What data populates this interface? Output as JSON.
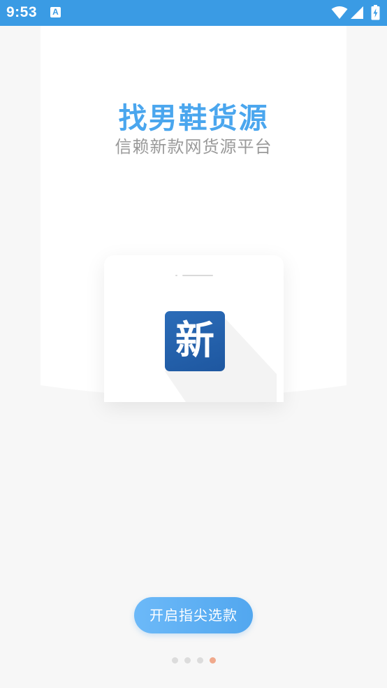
{
  "status_bar": {
    "time": "9:53",
    "notification_icon": "A",
    "icons": [
      "wifi-icon",
      "signal-icon",
      "battery-charging-icon"
    ],
    "background": "#3a9be4"
  },
  "intro": {
    "headline": "找男鞋货源",
    "subheadline": "信赖新款网货源平台",
    "headline_color": "#4aa6ee",
    "subheadline_color": "#9a9a9a"
  },
  "app_icon": {
    "glyph": "新",
    "color": "#2b6cb8"
  },
  "cta": {
    "label": "开启指尖选款",
    "color": "#5aaef2"
  },
  "pager": {
    "total": 4,
    "active_index": 3,
    "active_color": "#f0a98c",
    "inactive_color": "#dcdcdc"
  }
}
